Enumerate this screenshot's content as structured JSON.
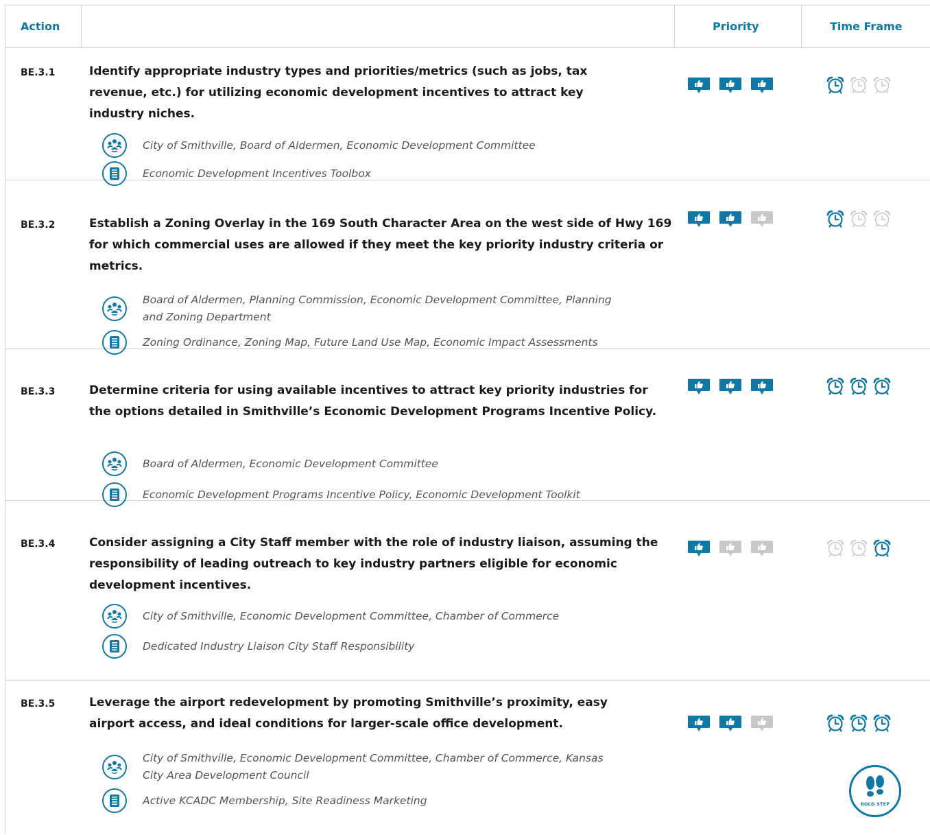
{
  "header": {
    "action": "Action",
    "priority": "Priority",
    "time_frame": "Time Frame"
  },
  "colors": {
    "accent": "#0f78a6",
    "inactive": "#c8c8c8",
    "border": "#d3d3d3"
  },
  "rows": [
    {
      "id": "BE.3.1",
      "description": "Identify appropriate industry types and priorities/metrics (such as jobs, tax revenue, etc.) for utilizing economic development incentives to attract key industry niches.",
      "partners": "City of Smithville, Board of Aldermen, Economic Development Committee",
      "resources": "Economic Development Incentives Toolbox",
      "priority": [
        true,
        true,
        true
      ],
      "time_frame": [
        true,
        false,
        false
      ]
    },
    {
      "id": "BE.3.2",
      "description": "Establish a Zoning Overlay in the 169 South Character Area on the west side of Hwy 169 for which commercial uses are allowed if they meet the key priority industry criteria or metrics.",
      "partners": "Board of Aldermen, Planning Commission, Economic Development Committee, Planning and Zoning Department",
      "resources": "Zoning Ordinance, Zoning Map, Future Land Use Map, Economic Impact Assessments",
      "priority": [
        true,
        true,
        false
      ],
      "time_frame": [
        true,
        false,
        false
      ]
    },
    {
      "id": "BE.3.3",
      "description": "Determine criteria for using available incentives to attract key priority industries for the options detailed in Smithville’s Economic Development Programs Incentive Policy.",
      "partners": "Board of Aldermen, Economic Development Committee",
      "resources": "Economic Development Programs Incentive Policy, Economic Development Toolkit",
      "priority": [
        true,
        true,
        true
      ],
      "time_frame": [
        true,
        true,
        true
      ]
    },
    {
      "id": "BE.3.4",
      "description": "Consider assigning a City Staff member with the role of industry liaison, assuming the responsibility of leading outreach to key industry partners eligible for economic development incentives.",
      "partners": "City of Smithville, Economic Development Committee, Chamber of Commerce",
      "resources": "Dedicated Industry Liaison City Staff Responsibility",
      "priority": [
        true,
        false,
        false
      ],
      "time_frame": [
        false,
        false,
        true
      ]
    },
    {
      "id": "BE.3.5",
      "description": "Leverage the airport redevelopment by promoting Smithville’s proximity, easy airport access, and ideal conditions for larger-scale office development.",
      "partners": "City of Smithville, Economic Development Committee, Chamber of Commerce, Kansas City Area Development Council",
      "resources": "Active KCADC Membership, Site Readiness Marketing",
      "priority": [
        true,
        true,
        false
      ],
      "time_frame": [
        true,
        true,
        true
      ],
      "badge": "BOLD STEP"
    }
  ],
  "icons": {
    "partners": "people-group-icon",
    "resources": "document-list-icon",
    "priority": "thumbs-up-icon",
    "time_frame": "alarm-clock-icon",
    "badge": "footprints-icon"
  }
}
